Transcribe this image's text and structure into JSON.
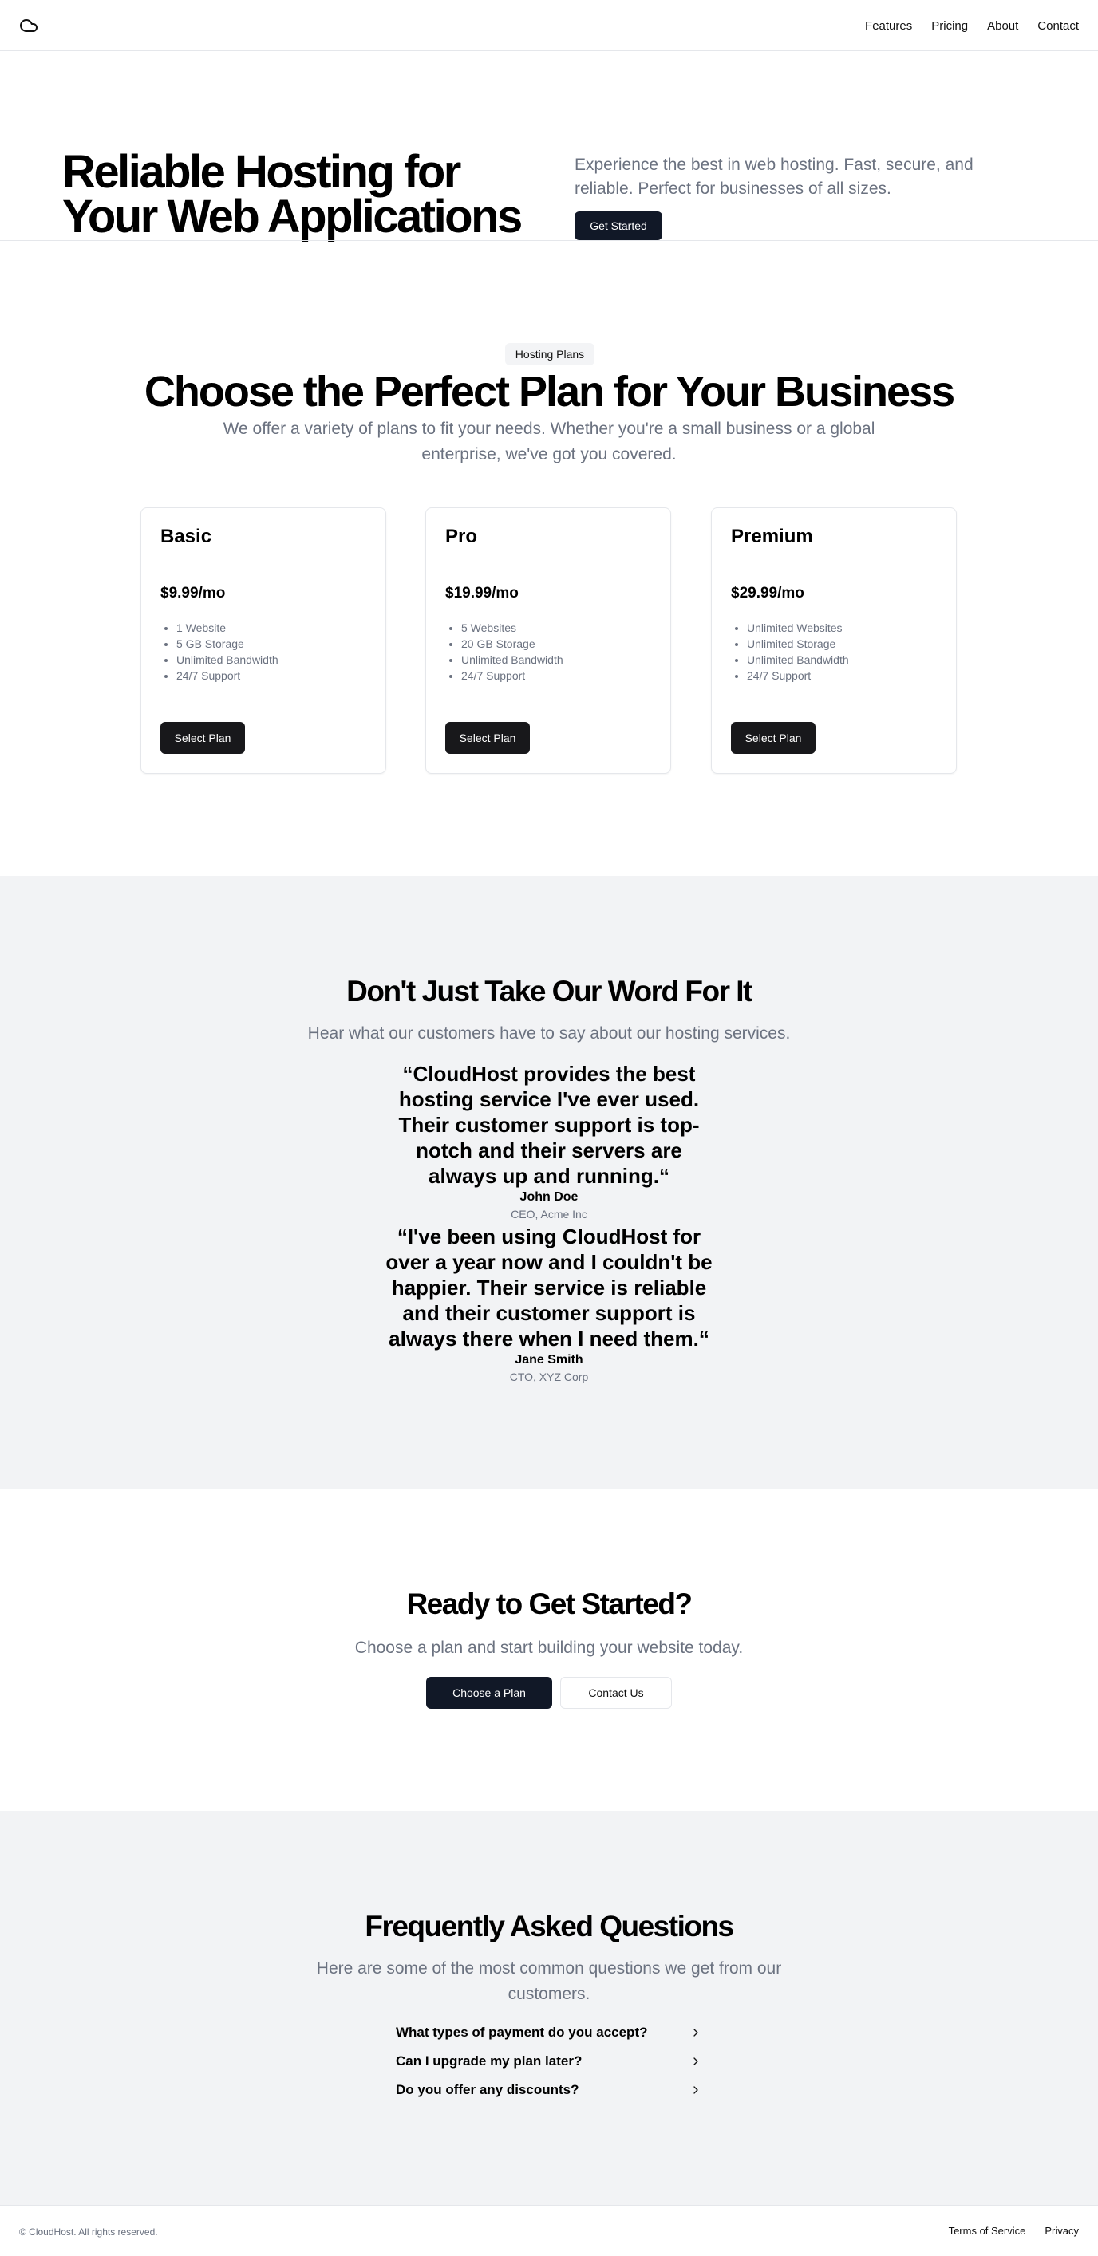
{
  "header": {
    "logo_icon": "cloud-icon",
    "nav": [
      "Features",
      "Pricing",
      "About",
      "Contact"
    ]
  },
  "hero": {
    "title_line1": "Reliable Hosting for",
    "title_line2": "Your Web Applications",
    "description": "Experience the best in web hosting. Fast, secure, and reliable. Perfect for businesses of all sizes.",
    "cta": "Get Started"
  },
  "pricing": {
    "badge": "Hosting Plans",
    "title": "Choose the Perfect Plan for Your Business",
    "description": "We offer a variety of plans to fit your needs. Whether you're a small business or a global enterprise, we've got you covered.",
    "plans": [
      {
        "name": "Basic",
        "price": "$9.99/mo",
        "features": [
          "1 Website",
          "5 GB Storage",
          "Unlimited Bandwidth",
          "24/7 Support"
        ],
        "button": "Select Plan"
      },
      {
        "name": "Pro",
        "price": "$19.99/mo",
        "features": [
          "5 Websites",
          "20 GB Storage",
          "Unlimited Bandwidth",
          "24/7 Support"
        ],
        "button": "Select Plan"
      },
      {
        "name": "Premium",
        "price": "$29.99/mo",
        "features": [
          "Unlimited Websites",
          "Unlimited Storage",
          "Unlimited Bandwidth",
          "24/7 Support"
        ],
        "button": "Select Plan"
      }
    ]
  },
  "testimonials": {
    "title": "Don't Just Take Our Word For It",
    "subtitle": "Hear what our customers have to say about our hosting services.",
    "items": [
      {
        "quote": "“CloudHost provides the best hosting service I've ever used. Their customer support is top-notch and their servers are always up and running.“",
        "name": "John Doe",
        "role": "CEO, Acme Inc"
      },
      {
        "quote": "“I've been using CloudHost for over a year now and I couldn't be happier. Their service is reliable and their customer support is always there when I need them.“",
        "name": "Jane Smith",
        "role": "CTO, XYZ Corp"
      }
    ]
  },
  "cta": {
    "title": "Ready to Get Started?",
    "subtitle": "Choose a plan and start building your website today.",
    "primary": "Choose a Plan",
    "secondary": "Contact Us"
  },
  "faq": {
    "title": "Frequently Asked Questions",
    "subtitle": "Here are some of the most common questions we get from our customers.",
    "questions": [
      "What types of payment do you accept?",
      "Can I upgrade my plan later?",
      "Do you offer any discounts?"
    ]
  },
  "footer": {
    "copyright": "© CloudHost. All rights reserved.",
    "links": [
      "Terms of Service",
      "Privacy"
    ]
  }
}
